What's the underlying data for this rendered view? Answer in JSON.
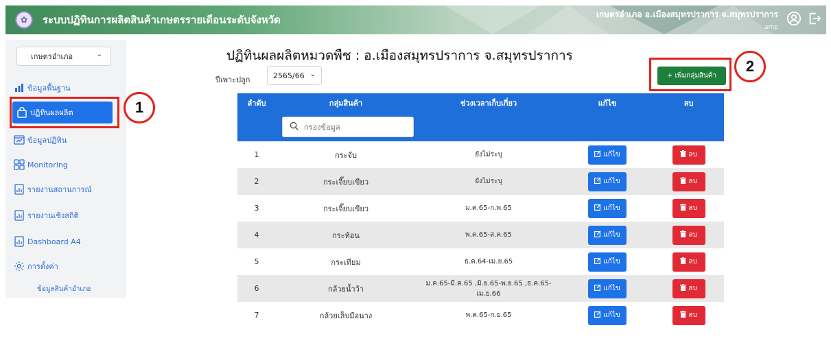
{
  "header": {
    "title": "ระบบปฏิทินการผลิตสินค้าเกษตรรายเดือนระดับจังหวัด",
    "user_name": "เกษตรอำเภอ อ.เมืองสมุทรปราการ จ.สมุทรปราการ",
    "user_id": "amp",
    "icons": [
      "account-circle-icon",
      "logout-icon"
    ]
  },
  "sidebar": {
    "dept_select": "เกษตรอำเภอ",
    "items": [
      {
        "label": "ข้อมูลพื้นฐาน",
        "icon": "bar-chart-icon"
      },
      {
        "label": "ปฏิทินผลผลิต",
        "icon": "bag-icon",
        "active": true
      },
      {
        "label": "ข้อมูลปฏิทิน",
        "icon": "calendar-chart-icon"
      },
      {
        "label": "Monitoring",
        "icon": "grid-icon"
      },
      {
        "label": "รายงานสถานการณ์",
        "icon": "report-icon"
      },
      {
        "label": "รายงานเชิงสถิติ",
        "icon": "report-icon"
      },
      {
        "label": "Dashboard A4",
        "icon": "report-icon"
      },
      {
        "label": "การตั้งค่า",
        "icon": "gear-icon"
      }
    ],
    "sub_item": "ข้อมูลสินค้าอำเภอ"
  },
  "main": {
    "title": "ปฏิทินผลผลิตหมวดพืช : อ.เมืองสมุทรปราการ จ.สมุทรปราการ",
    "season_label": "ปีเพาะปลูก",
    "season_value": "2565/66",
    "add_button": "+ เพิ่มกลุ่มสินค้า"
  },
  "annotations": {
    "one": "1",
    "two": "2"
  },
  "table": {
    "headers": [
      "ลำดับ",
      "กลุ่มสินค้า",
      "ช่วงเวลาเก็บเกี่ยว",
      "แก้ไข",
      "ลบ"
    ],
    "filter_placeholder": "กรองข้อมูล",
    "edit_label": "แก้ไข",
    "delete_label": "ลบ",
    "rows": [
      {
        "no": "1",
        "group": "กระจับ",
        "period": "ยังไม่ระบุ"
      },
      {
        "no": "2",
        "group": "กระเจี๊ยบเขียว",
        "period": "ยังไม่ระบุ"
      },
      {
        "no": "3",
        "group": "กระเจี๊ยบเขียว",
        "period": "ม.ค.65-ก.พ.65"
      },
      {
        "no": "4",
        "group": "กระท้อน",
        "period": "พ.ค.65-ส.ค.65"
      },
      {
        "no": "5",
        "group": "กระเทียม",
        "period": "ธ.ค.64-เม.ย.65"
      },
      {
        "no": "6",
        "group": "กล้วยน้ำว้า",
        "period": "ม.ค.65-มี.ค.65 ,มิ.ย.65-พ.ย.65 ,ธ.ค.65-เม.ย.66"
      },
      {
        "no": "7",
        "group": "กล้วยเล็บมือนาง",
        "period": "พ.ค.65-ก.ย.65"
      }
    ]
  }
}
